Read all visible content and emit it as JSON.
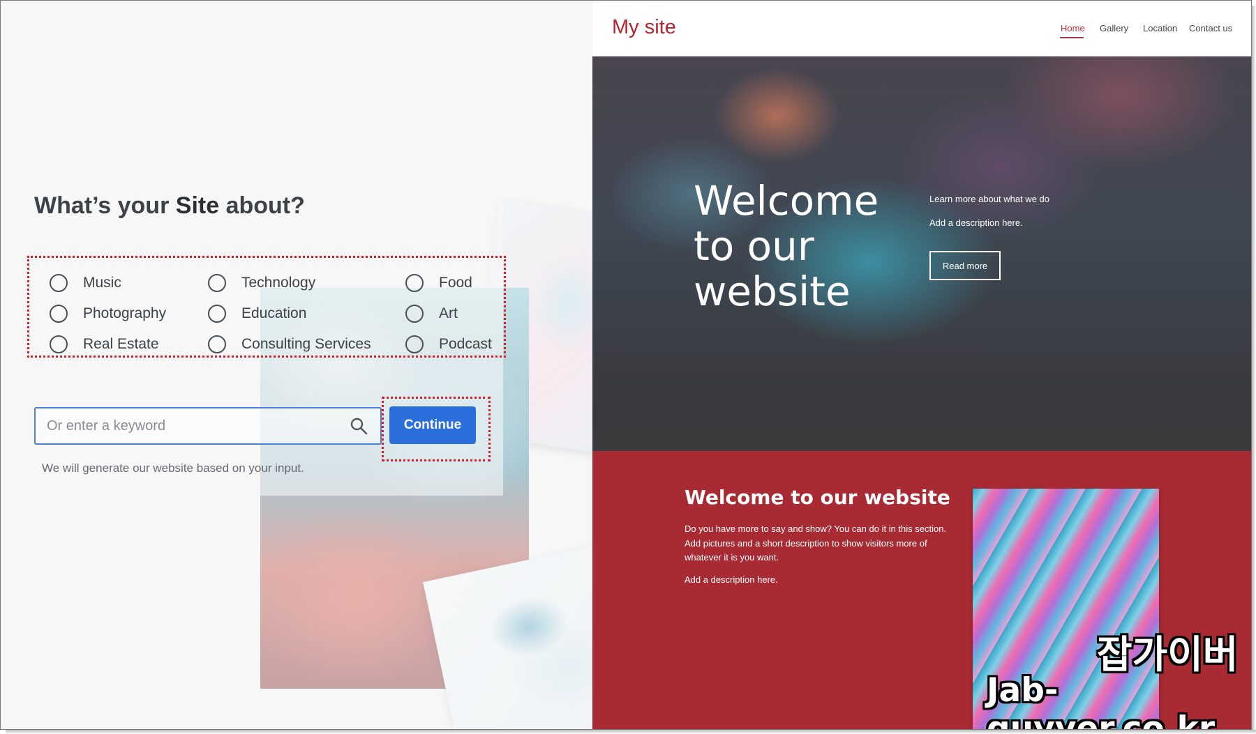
{
  "wizard": {
    "question_prefix": "What’s your ",
    "question_bold": "Site",
    "question_suffix": " about?",
    "options": [
      "Music",
      "Technology",
      "Food",
      "Photography",
      "Education",
      "Art",
      "Real Estate",
      "Consulting Services",
      "Podcast"
    ],
    "keyword_placeholder": "Or enter a keyword",
    "continue_label": "Continue",
    "helper_text": "We will generate our website based on your input."
  },
  "preview": {
    "logo": "My site",
    "nav": [
      "Home",
      "Gallery",
      "Location",
      "Contact us"
    ],
    "active_nav": "Home",
    "hero_title": "Welcome to our website",
    "hero_side_line1": "Learn more about what we do",
    "hero_side_line2": "Add a description here.",
    "read_more_label": "Read more",
    "section_title": "Welcome to our website",
    "section_body": "Do you have more to say and show? You can do it in this section. Add pictures and a short description to show visitors more of whatever it is you want.",
    "section_body2": "Add a description here."
  },
  "watermark": {
    "korean": "잡가이버",
    "domain": "Jab-guyver.co.kr"
  },
  "colors": {
    "accent_red": "#a82b34",
    "logo_red": "#b3262f",
    "button_blue": "#2a6fdb",
    "highlight_dotted": "#d31f2a"
  }
}
